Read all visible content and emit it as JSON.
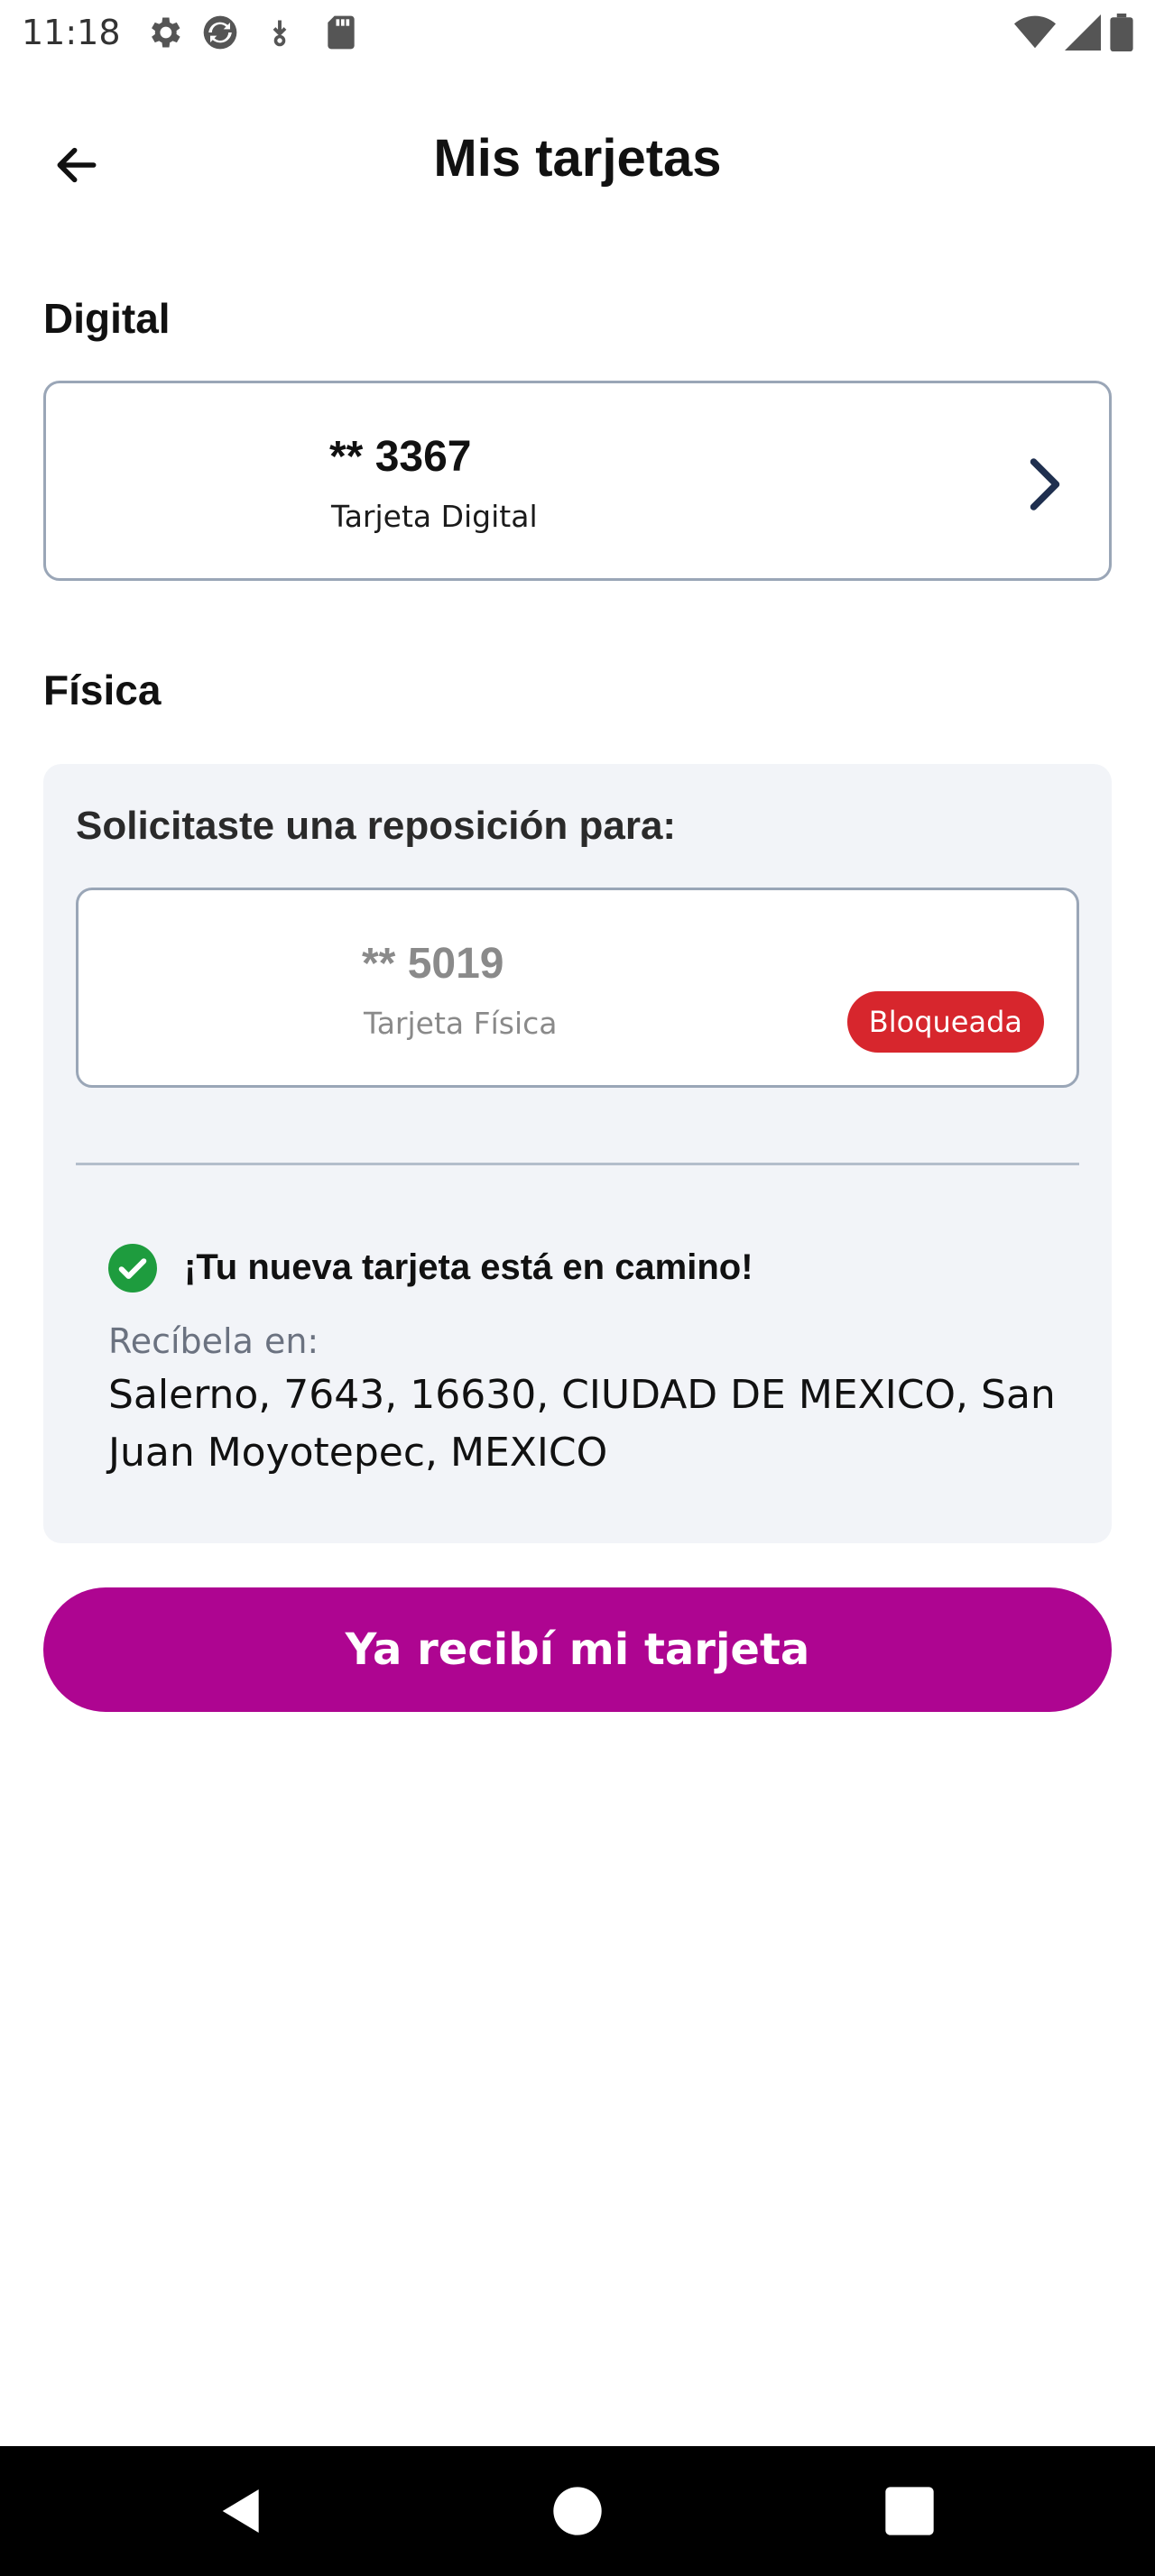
{
  "status_bar": {
    "time": "11:18",
    "left_icons": [
      "gear-icon",
      "sync-icon",
      "download-icon",
      "sd-card-icon"
    ],
    "right_icons": [
      "wifi-icon",
      "signal-icon",
      "battery-icon"
    ]
  },
  "header": {
    "title": "Mis tarjetas",
    "back_icon": "arrow-left-icon"
  },
  "sections": {
    "digital_title": "Digital",
    "physical_title": "Física"
  },
  "digital_card": {
    "number": "** 3367",
    "type": "Tarjeta Digital"
  },
  "physical_panel": {
    "title": "Solicitaste una reposición para:",
    "card_number": "** 5019",
    "card_type": "Tarjeta Física",
    "badge": "Bloqueada",
    "notice": "¡Tu nueva tarjeta está en camino!",
    "address_label": "Recíbela en:",
    "address_value": "Salerno, 7643, 16630, CIUDAD DE MEXICO, San Juan Moyotepec, MEXICO"
  },
  "primary_button": {
    "label": "Ya recibí mi tarjeta"
  },
  "colors": {
    "accent": "#ae0591",
    "badge_red": "#d7262d",
    "success_green": "#1e9c3e",
    "chevron": "#1f2f4f"
  }
}
